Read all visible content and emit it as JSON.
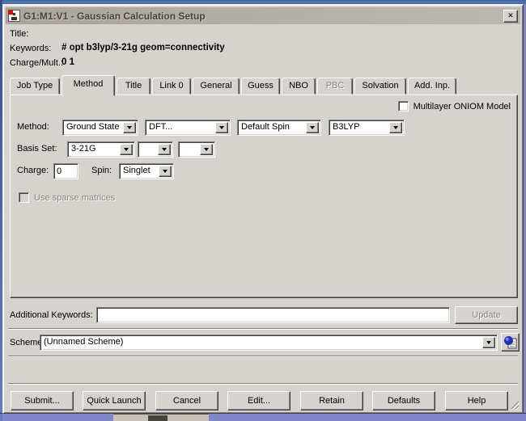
{
  "window": {
    "title": "G1:M1:V1 - Gaussian Calculation Setup",
    "close_glyph": "✕"
  },
  "header": {
    "title_label": "Title:",
    "title_value": "",
    "keywords_label": "Keywords:",
    "keywords_value": "# opt b3lyp/3-21g geom=connectivity",
    "charge_mult_label": "Charge/Mult.:",
    "charge_mult_value": "0 1"
  },
  "tabs": [
    {
      "label": "Job Type",
      "active": false,
      "disabled": false
    },
    {
      "label": "Method",
      "active": true,
      "disabled": false
    },
    {
      "label": "Title",
      "active": false,
      "disabled": false
    },
    {
      "label": "Link 0",
      "active": false,
      "disabled": false
    },
    {
      "label": "General",
      "active": false,
      "disabled": false
    },
    {
      "label": "Guess",
      "active": false,
      "disabled": false
    },
    {
      "label": "NBO",
      "active": false,
      "disabled": false
    },
    {
      "label": "PBC",
      "active": false,
      "disabled": true
    },
    {
      "label": "Solvation",
      "active": false,
      "disabled": false
    },
    {
      "label": "Add. Inp.",
      "active": false,
      "disabled": false
    }
  ],
  "method_tab": {
    "oniom_checkbox_label": "Multilayer ONIOM Model",
    "oniom_checked": false,
    "method_label": "Method:",
    "combos": [
      "Ground State",
      "DFT...",
      "Default Spin",
      "B3LYP"
    ],
    "basis_label": "Basis Set:",
    "basis_combos": [
      "3-21G",
      "",
      ""
    ],
    "charge_label": "Charge:",
    "charge_value": "0",
    "spin_label": "Spin:",
    "spin_value": "Singlet",
    "sparse_checkbox_label": "Use sparse matrices",
    "sparse_checked": false
  },
  "additional_keywords": {
    "label": "Additional Keywords:",
    "value": "",
    "update_button": "Update"
  },
  "scheme": {
    "label": "Scheme:",
    "value": "(Unnamed Scheme)"
  },
  "footer": {
    "buttons": [
      "Submit...",
      "Quick Launch",
      "Cancel",
      "Edit...",
      "Retain",
      "Defaults",
      "Help"
    ]
  },
  "colors": {
    "dialog_face": "#d6d3ce",
    "frame_top_blue": "#4d7ab5",
    "background_blue": "#8187ca",
    "titlebar_gray": "#b2aea7"
  }
}
